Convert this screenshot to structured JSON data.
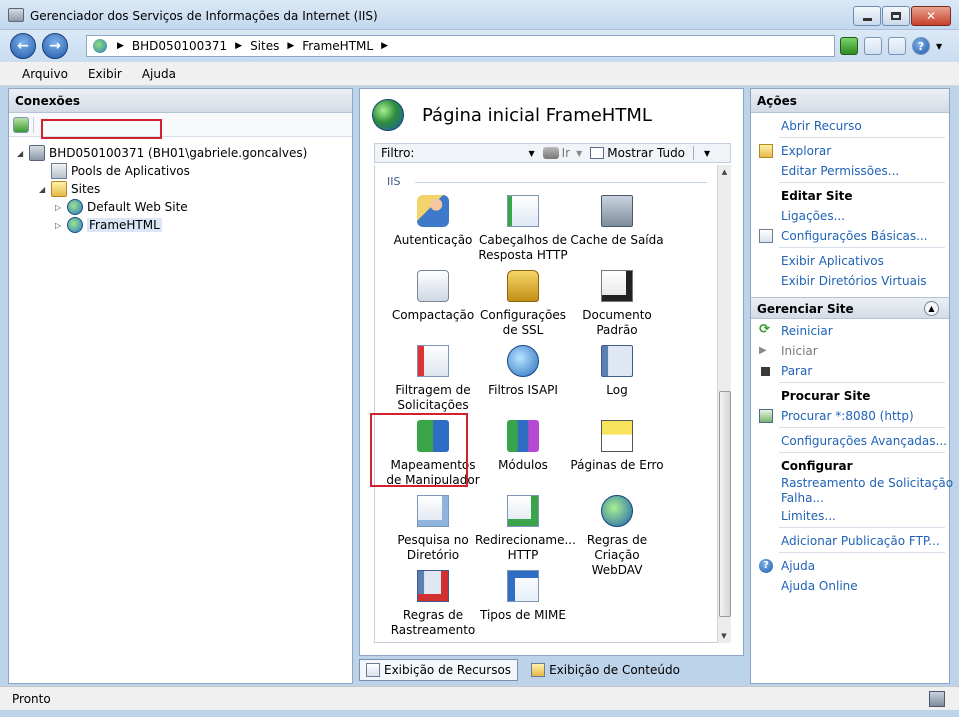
{
  "window": {
    "title": "Gerenciador dos Serviços de Informações da Internet (IIS)"
  },
  "address": {
    "crumbs": [
      "BHD050100371",
      "Sites",
      "FrameHTML"
    ]
  },
  "menu": [
    "Arquivo",
    "Exibir",
    "Ajuda"
  ],
  "connections": {
    "header": "Conexões",
    "server": "BHD050100371 (BH01\\gabriele.goncalves)",
    "pools": "Pools de Aplicativos",
    "sites": "Sites",
    "default_site": "Default Web Site",
    "framehtml": "FrameHTML"
  },
  "center": {
    "title": "Página inicial FrameHTML",
    "filter_label": "Filtro:",
    "go_label": "Ir",
    "show_all_label": "Mostrar Tudo",
    "group": "IIS",
    "features": [
      {
        "line1": "Autenticação",
        "line2": ""
      },
      {
        "line1": "Cabeçalhos de",
        "line2": "Resposta HTTP"
      },
      {
        "line1": "Cache de Saída",
        "line2": ""
      },
      {
        "line1": "Compactação",
        "line2": ""
      },
      {
        "line1": "Configurações",
        "line2": "de SSL"
      },
      {
        "line1": "Documento",
        "line2": "Padrão"
      },
      {
        "line1": "Filtragem de",
        "line2": "Solicitações"
      },
      {
        "line1": "Filtros ISAPI",
        "line2": ""
      },
      {
        "line1": "Log",
        "line2": ""
      },
      {
        "line1": "Mapeamentos",
        "line2": "de Manipulador"
      },
      {
        "line1": "Módulos",
        "line2": ""
      },
      {
        "line1": "Páginas de Erro",
        "line2": ""
      },
      {
        "line1": "Pesquisa no",
        "line2": "Diretório"
      },
      {
        "line1": "Redirecioname...",
        "line2": "HTTP"
      },
      {
        "line1": "Regras de",
        "line2": "Criação WebDAV"
      },
      {
        "line1": "Regras de",
        "line2": "Rastreamento ..."
      },
      {
        "line1": "Tipos de MIME",
        "line2": ""
      }
    ],
    "tab_features": "Exibição de Recursos",
    "tab_content": "Exibição de Conteúdo"
  },
  "actions": {
    "header": "Ações",
    "open_feature": "Abrir Recurso",
    "explore": "Explorar",
    "edit_permissions": "Editar Permissões...",
    "edit_site": "Editar Site",
    "bindings": "Ligações...",
    "basic_settings": "Configurações Básicas...",
    "view_apps": "Exibir Aplicativos",
    "view_vdirs": "Exibir Diretórios Virtuais",
    "manage_site": "Gerenciar Site",
    "restart": "Reiniciar",
    "start": "Iniciar",
    "stop": "Parar",
    "browse_site": "Procurar Site",
    "browse_8080": "Procurar *:8080 (http)",
    "advanced": "Configurações Avançadas...",
    "configure": "Configurar",
    "failed_trace_1": "Rastreamento de Solicitação",
    "failed_trace_2": "Falha...",
    "limits": "Limites...",
    "add_ftp": "Adicionar Publicação FTP...",
    "help": "Ajuda",
    "help_online": "Ajuda Online"
  },
  "status": {
    "text": "Pronto"
  }
}
